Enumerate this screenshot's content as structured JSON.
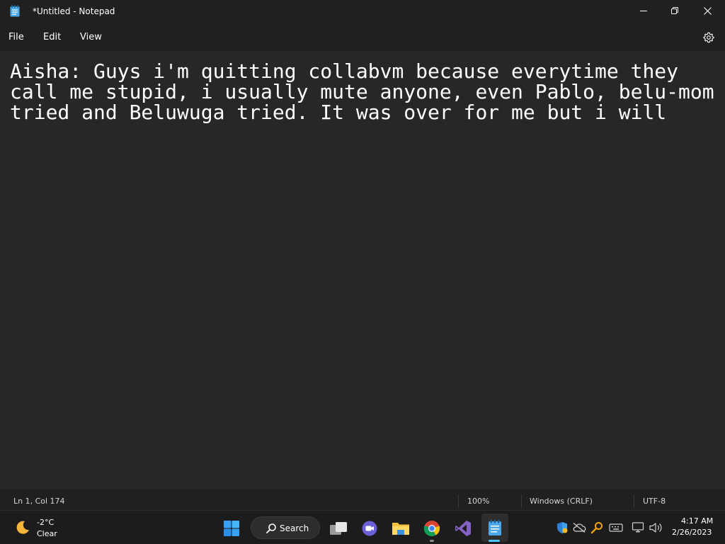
{
  "window": {
    "title": "*Untitled - Notepad",
    "icon": "notepad-icon",
    "controls": {
      "minimize": "minimize-icon",
      "maximize": "maximize-icon",
      "close": "close-icon"
    }
  },
  "menu": {
    "items": [
      {
        "label": "File"
      },
      {
        "label": "Edit"
      },
      {
        "label": "View"
      }
    ],
    "settings_icon": "gear-icon"
  },
  "editor": {
    "text": "Aisha: Guys i'm quitting collabvm because everytime they\ncall me stupid, i usually mute anyone, even Pablo, belu-mom\ntried and Beluwuga tried. It was over for me but i will"
  },
  "status": {
    "position": "Ln 1, Col 174",
    "zoom": "100%",
    "line_ending": "Windows (CRLF)",
    "encoding": "UTF-8"
  },
  "taskbar": {
    "weather": {
      "temperature": "-2°C",
      "condition": "Clear",
      "icon": "moon-icon"
    },
    "search_label": "Search",
    "apps": [
      "start-icon",
      "search-icon",
      "task-view-icon",
      "teams-icon",
      "file-explorer-icon",
      "chrome-icon",
      "visual-studio-icon",
      "notepad-icon"
    ],
    "tray": [
      "shield-icon",
      "cloud-off-icon",
      "key-icon",
      "keyboard-icon",
      "network-icon",
      "volume-icon"
    ],
    "clock": {
      "time": "4:17 AM",
      "date": "2/26/2023"
    }
  },
  "colors": {
    "accent": "#4cc2ff",
    "editor_bg": "#272727",
    "chrome_bg": "#202020",
    "taskbar_bg": "#1c1c1c"
  }
}
